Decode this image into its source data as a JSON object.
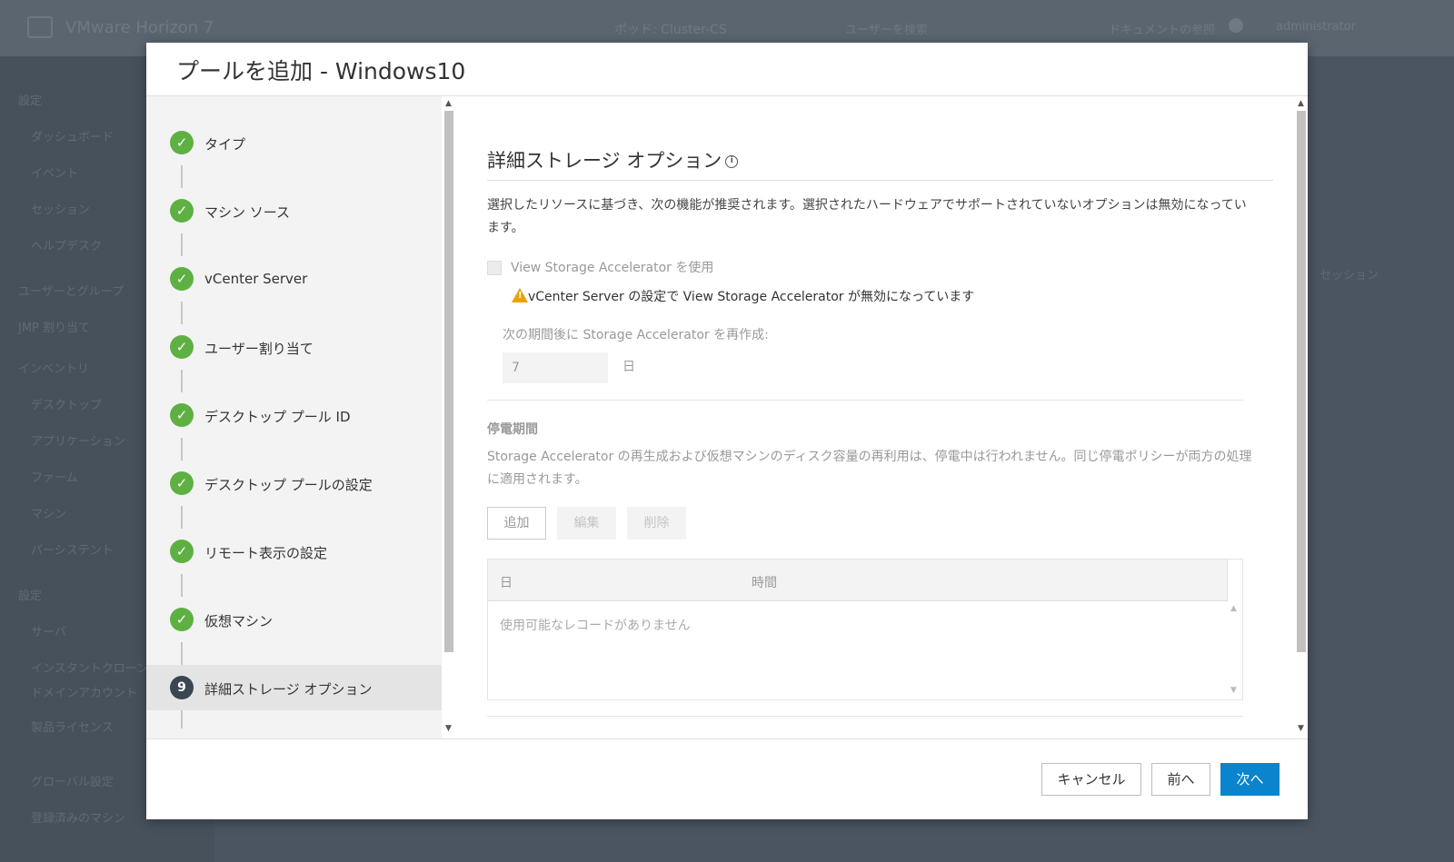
{
  "background": {
    "brand": "VMware Horizon 7",
    "center_text": "ポッド: Cluster-CS",
    "search_text": "ユーザーを検索",
    "right_text": "ドキュメントの参照",
    "user_text": "administrator",
    "sidebar_items": [
      {
        "label": "設定",
        "section": true
      },
      {
        "label": "ダッシュボード"
      },
      {
        "label": "イベント"
      },
      {
        "label": "セッション"
      },
      {
        "label": "ヘルプデスク"
      },
      {
        "label": "ユーザーとグループ",
        "section": true
      },
      {
        "label": "JMP 割り当て",
        "section": true
      },
      {
        "label": "インベントリ",
        "section": true
      },
      {
        "label": "デスクトップ"
      },
      {
        "label": "アプリケーション"
      },
      {
        "label": "ファーム"
      },
      {
        "label": "マシン"
      },
      {
        "label": "パーシステント"
      },
      {
        "label": "設定",
        "section": true
      },
      {
        "label": "サーバ"
      },
      {
        "label": "インスタントクローン"
      },
      {
        "label": "ドメインアカウント"
      },
      {
        "label": "製品ライセンス"
      },
      {
        "label": "グローバル設定"
      },
      {
        "label": "登録済みのマシン"
      }
    ],
    "main_session_text": "セッション"
  },
  "modal": {
    "title": "プールを追加 - Windows10"
  },
  "steps": [
    {
      "label": "タイプ",
      "done": true
    },
    {
      "label": "マシン ソース",
      "done": true
    },
    {
      "label": "vCenter Server",
      "done": true
    },
    {
      "label": "ユーザー割り当て",
      "done": true
    },
    {
      "label": "デスクトップ プール ID",
      "done": true
    },
    {
      "label": "デスクトップ プールの設定",
      "done": true
    },
    {
      "label": "リモート表示の設定",
      "done": true
    },
    {
      "label": "仮想マシン",
      "done": true
    },
    {
      "label": "詳細ストレージ オプション",
      "done": false,
      "number": "9",
      "active": true
    }
  ],
  "content": {
    "help_icon": "question-icon",
    "section_title": "詳細ストレージ オプション",
    "description": "選択したリソースに基づき、次の機能が推奨されます。選択されたハードウェアでサポートされていないオプションは無効になっています。",
    "checkbox_label": "View Storage Accelerator を使用",
    "checkbox_checked": false,
    "warning_text": "vCenter Server の設定で View Storage Accelerator が無効になっています",
    "regen_label": "次の期間後に Storage Accelerator を再作成:",
    "regen_days_value": "7",
    "regen_days_unit": "日",
    "blackout_title": "停電期間",
    "blackout_description": "Storage Accelerator の再生成および仮想マシンのディスク容量の再利用は、停電中は行われません。同じ停電ポリシーが両方の処理に適用されます。",
    "buttons": {
      "add": "追加",
      "edit": "編集",
      "delete": "削除"
    },
    "grid": {
      "columns": [
        "日",
        "時間"
      ],
      "empty_text": "使用可能なレコードがありません"
    }
  },
  "footer": {
    "cancel": "キャンセル",
    "prev": "前へ",
    "next": "次へ"
  },
  "colors": {
    "accent": "#0a84cc",
    "check_green": "#5eb043",
    "warning": "#e9a300"
  }
}
